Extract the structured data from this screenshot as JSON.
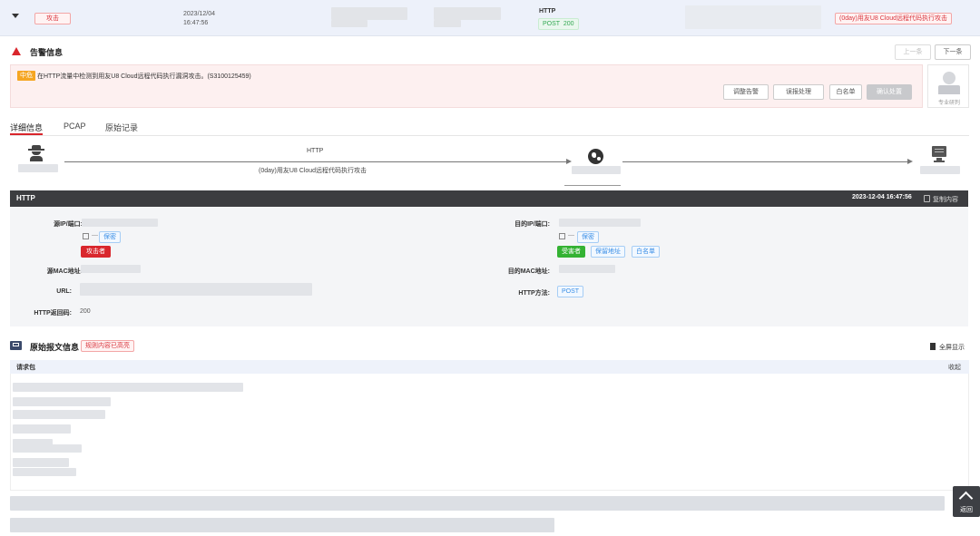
{
  "topbar": {
    "type_tag": "攻击",
    "date": "2023/12/04",
    "time": "16:47:56",
    "protocol": "HTTP",
    "method_status": "POST  200",
    "event_tag": "(0day)用友U8 Cloud远程代码执行攻击"
  },
  "alert": {
    "title": "告警信息",
    "prev": "上一条",
    "next": "下一条",
    "level": "中危",
    "message": "在HTTP流量中检测到用友U8 Cloud远程代码执行漏洞攻击。(S3100125459)",
    "buttons": [
      "调整告警",
      "误报处理",
      "白名单",
      "确认处置"
    ],
    "expert_label": "专业研判"
  },
  "tabs": [
    "详细信息",
    "PCAP",
    "原始记录"
  ],
  "flow": {
    "protocol": "HTTP",
    "attack_name": "(0day)用友U8 Cloud远程代码执行攻击"
  },
  "http_panel": {
    "title": "HTTP",
    "timestamp": "2023-12-04 16:47:56",
    "copy": "复制内容",
    "src_ip_label": "源IP/端口:",
    "src_link_suffix": "— ",
    "src_link": "保密",
    "attacker_tag": "攻击者",
    "dst_ip_label": "目的IP/端口:",
    "dst_link": "保密",
    "victim_tag": "受害者",
    "keep_addr": "保留地址",
    "whitelist": "白名单",
    "src_mac_label": "源MAC地址:",
    "dst_mac_label": "目的MAC地址:",
    "url_label": "URL:",
    "http_method_label": "HTTP方法:",
    "http_method": "POST",
    "status_label": "HTTP返回码:",
    "status": "200"
  },
  "raw": {
    "title": "原始报文信息",
    "tag": "规则内容已高亮",
    "fullscreen": "全屏显示",
    "request_label": "请求包",
    "collapse": "收起",
    "back_top": "返回"
  }
}
